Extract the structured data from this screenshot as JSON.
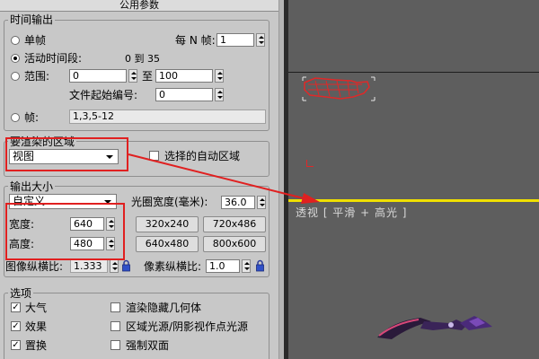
{
  "panel": {
    "title": "公用参数",
    "time_output": {
      "legend": "时间输出",
      "single_frame": "单帧",
      "every_n_label": "每 N 帧:",
      "every_n_value": "1",
      "active_segment": "活动时间段:",
      "active_range": "0 到 35",
      "range": "范围:",
      "range_from": "0",
      "range_to_label": "至",
      "range_to": "100",
      "file_start_label": "文件起始编号:",
      "file_start": "0",
      "frames": "帧:",
      "frames_value": "1,3,5-12"
    },
    "render_area": {
      "legend": "要渲染的区域",
      "selected": "视图",
      "auto_region": "选择的自动区域"
    },
    "output_size": {
      "legend": "输出大小",
      "preset": "自定义",
      "aperture_label": "光圈宽度(毫米):",
      "aperture_value": "36.0",
      "width_label": "宽度:",
      "width_value": "640",
      "height_label": "高度:",
      "height_value": "480",
      "presets": [
        "320x240",
        "720x486",
        "640x480",
        "800x600"
      ],
      "image_aspect_label": "图像纵横比:",
      "image_aspect_value": "1.333",
      "pixel_aspect_label": "像素纵横比:",
      "pixel_aspect_value": "1.0"
    },
    "options": {
      "legend": "选项",
      "left": [
        {
          "label": "大气",
          "checked": true
        },
        {
          "label": "效果",
          "checked": true
        },
        {
          "label": "置换",
          "checked": true
        }
      ],
      "right": [
        {
          "label": "渲染隐藏几何体",
          "checked": false
        },
        {
          "label": "区域光源/阴影视作点光源",
          "checked": false
        },
        {
          "label": "强制双面",
          "checked": false
        }
      ]
    }
  },
  "viewport": {
    "label": "透视 [ 平滑 + 高光 ]"
  },
  "colors": {
    "annotation": "#e02020",
    "viewport_bg": "#5e5e5e",
    "viewport_active_border": "#f0e000",
    "panel_bg": "#c8c8c8"
  }
}
